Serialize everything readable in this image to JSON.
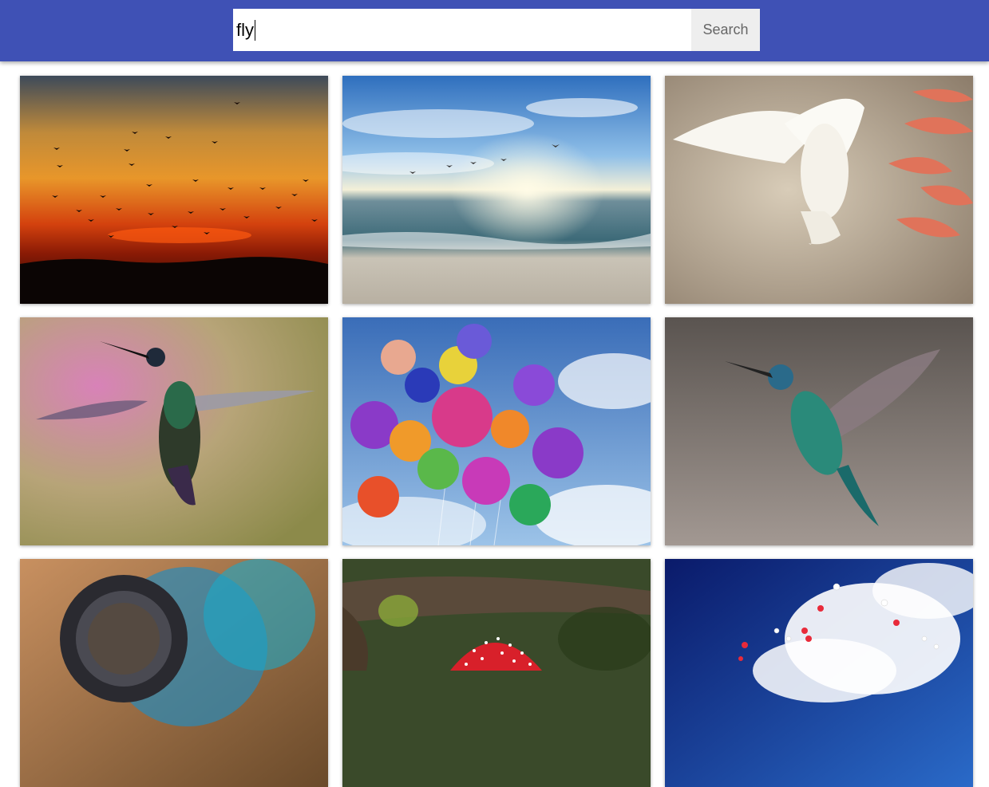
{
  "search": {
    "value": "fly",
    "button_label": "Search"
  },
  "colors": {
    "header": "#3f51b5",
    "button_bg": "#eeeeee"
  },
  "results": [
    {
      "name": "sunset-birds-image",
      "subject": "birds-flock-over-sunset"
    },
    {
      "name": "beach-seagulls-image",
      "subject": "seagulls-over-beach"
    },
    {
      "name": "white-dove-image",
      "subject": "white-dove-with-leaves"
    },
    {
      "name": "hummingbird-pink-image",
      "subject": "hummingbird-pink-background"
    },
    {
      "name": "balloons-image",
      "subject": "colorful-balloons-sky"
    },
    {
      "name": "hummingbird-gray-image",
      "subject": "hummingbird-gray-background"
    },
    {
      "name": "fly-macro-image",
      "subject": "fly-eye-macro"
    },
    {
      "name": "mushroom-image",
      "subject": "red-mushroom-branch"
    },
    {
      "name": "heart-balloons-sky-image",
      "subject": "heart-balloons-blue-sky"
    }
  ]
}
